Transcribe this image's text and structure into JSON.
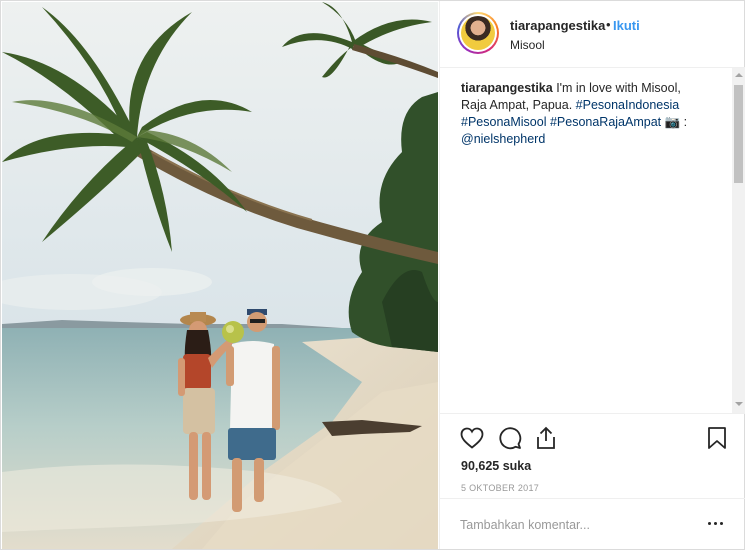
{
  "post": {
    "username": "tiarapangestika",
    "separator": "•",
    "follow_label": "Ikuti",
    "location": "Misool",
    "caption": {
      "username": "tiarapangestika",
      "text_1": " I'm in love with Misool, Raja Ampat, Papua. ",
      "hashtag_1": "#PesonaIndonesia",
      "hashtag_2": "#PesonaMisool",
      "hashtag_3": "#PesonaRajaAmpat",
      "camera_emoji": "📷",
      "text_2": " : ",
      "mention": "@nielshepherd"
    },
    "likes_count": "90,625",
    "likes_suffix": " suka",
    "date": "5 OKTOBER 2017",
    "comment_placeholder": "Tambahkan komentar...",
    "icons": {
      "like": "heart-icon",
      "comment": "comment-icon",
      "share": "share-icon",
      "save": "bookmark-icon",
      "more": "more-options-icon"
    },
    "colors": {
      "follow_blue": "#3897f0",
      "hashtag_blue": "#003569"
    }
  }
}
